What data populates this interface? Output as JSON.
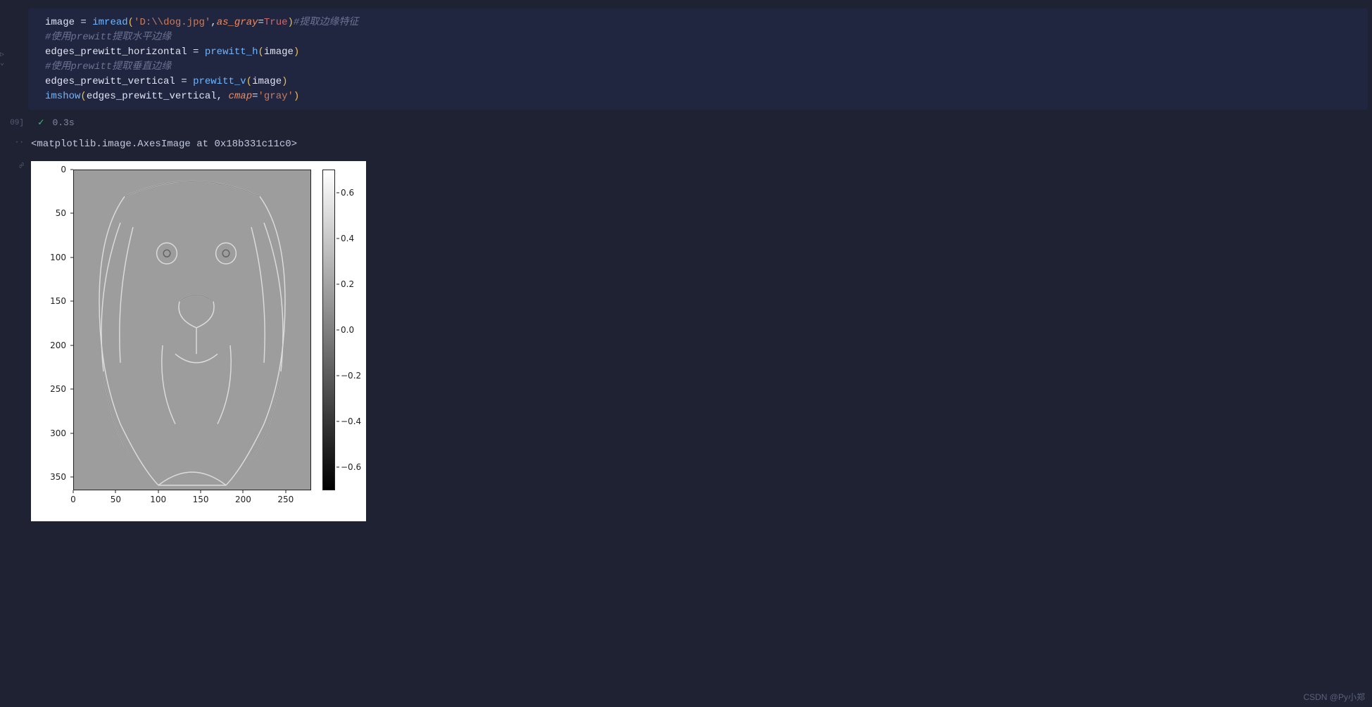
{
  "gutter": {
    "run_marker": "▷ ⌄",
    "exec_count": "09]",
    "output_marker": "··",
    "image_marker": "☍"
  },
  "code": {
    "line1": {
      "var_image": "image",
      "eq": " = ",
      "fn_imread": "imread",
      "lp": "(",
      "str_path": "'D:\\\\dog.jpg'",
      "comma": ",",
      "kw_asgray": "as_gray",
      "eq2": "=",
      "bool_true": "True",
      "rp": ")",
      "comment": "#提取边缘特征"
    },
    "line2_comment": "#使用prewitt提取水平边缘",
    "line3": {
      "var": "edges_prewitt_horizontal",
      "eq": " = ",
      "fn": "prewitt_h",
      "lp": "(",
      "arg": "image",
      "rp": ")"
    },
    "line4_comment": "#使用prewitt提取垂直边缘",
    "line5": {
      "var": "edges_prewitt_vertical",
      "eq": " = ",
      "fn": "prewitt_v",
      "lp": "(",
      "arg": "image",
      "rp": ")"
    },
    "line6": {
      "fn": "imshow",
      "lp": "(",
      "arg1": "edges_prewitt_vertical",
      "comma": ", ",
      "kw_cmap": "cmap",
      "eq": "=",
      "str_gray": "'gray'",
      "rp": ")"
    }
  },
  "status": {
    "check": "✓",
    "time": "0.3s"
  },
  "output_text": "<matplotlib.image.AxesImage at 0x18b331c11c0>",
  "chart_data": {
    "type": "heatmap",
    "title": "",
    "xlabel": "",
    "ylabel": "",
    "x_range": [
      0,
      280
    ],
    "y_range": [
      0,
      365
    ],
    "x_ticks": [
      0,
      50,
      100,
      150,
      200,
      250
    ],
    "y_ticks": [
      0,
      50,
      100,
      150,
      200,
      250,
      300,
      350
    ],
    "colorbar_ticks": [
      0.6,
      0.4,
      0.2,
      0.0,
      -0.2,
      -0.4,
      -0.6
    ],
    "colorbar_labels": [
      "0.6",
      "0.4",
      "0.2",
      "0.0",
      "−0.2",
      "−0.4",
      "−0.6"
    ],
    "colorbar_range": [
      -0.7,
      0.7
    ],
    "cmap": "gray",
    "description": "Prewitt vertical-edge filtered grayscale image of a dog"
  },
  "watermark": "CSDN @Py小郑"
}
